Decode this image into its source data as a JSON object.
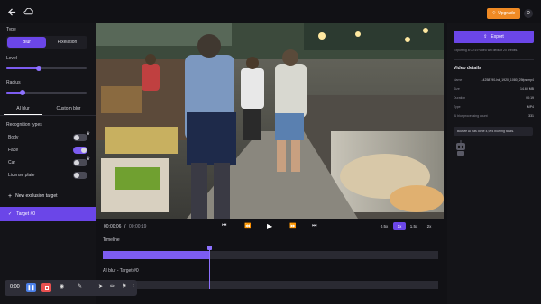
{
  "topbar": {
    "back_icon": "arrow-left-icon",
    "cloud_icon": "cloud-icon",
    "upgrade_label": "Upgrade",
    "avatar_initial": "D"
  },
  "left_panel": {
    "type_label": "Type",
    "type_options": [
      "Blur",
      "Pixelation"
    ],
    "type_selected": "Blur",
    "level_label": "Level",
    "level_value": 0.4,
    "radius_label": "Radius",
    "radius_value": 0.2,
    "tabs": [
      "AI blur",
      "Custom blur"
    ],
    "active_tab": "AI blur",
    "recognition_label": "Recognition types",
    "recognition_types": [
      {
        "label": "Body",
        "on": false,
        "premium": true
      },
      {
        "label": "Face",
        "on": true,
        "premium": false
      },
      {
        "label": "Car",
        "on": false,
        "premium": true
      },
      {
        "label": "License plate",
        "on": false,
        "premium": false
      }
    ],
    "new_target_label": "New exclusion target",
    "target_item_label": "Target #0"
  },
  "right_panel": {
    "export_label": "Export",
    "export_note": "Exporting a 00:19 video will deduct 20 credits.",
    "details_title": "Video details",
    "details": [
      {
        "key": "Name",
        "value": "...4258790-hd_1920_1080_25fps.mp4"
      },
      {
        "key": "Size",
        "value": "14.60 MB"
      },
      {
        "key": "Duration",
        "value": "00:19"
      },
      {
        "key": "Type",
        "value": "MP4"
      },
      {
        "key": "AI blur processing count",
        "value": "331"
      }
    ],
    "tip_text": "BlurMe AI has done 4,994 blurring tasks."
  },
  "player": {
    "current_time": "00:00:06",
    "total_time": "00:00:19",
    "speeds": [
      "0.5x",
      "1x",
      "1.5x",
      "2x"
    ],
    "active_speed": "1x"
  },
  "timeline": {
    "label": "Timeline",
    "progress": 0.32,
    "ai_label": "AI blur - Target #0"
  },
  "recorder": {
    "time": "0:00"
  },
  "colors": {
    "accent": "#6b46e8",
    "upgrade": "#f08a24",
    "background": "#111115"
  }
}
